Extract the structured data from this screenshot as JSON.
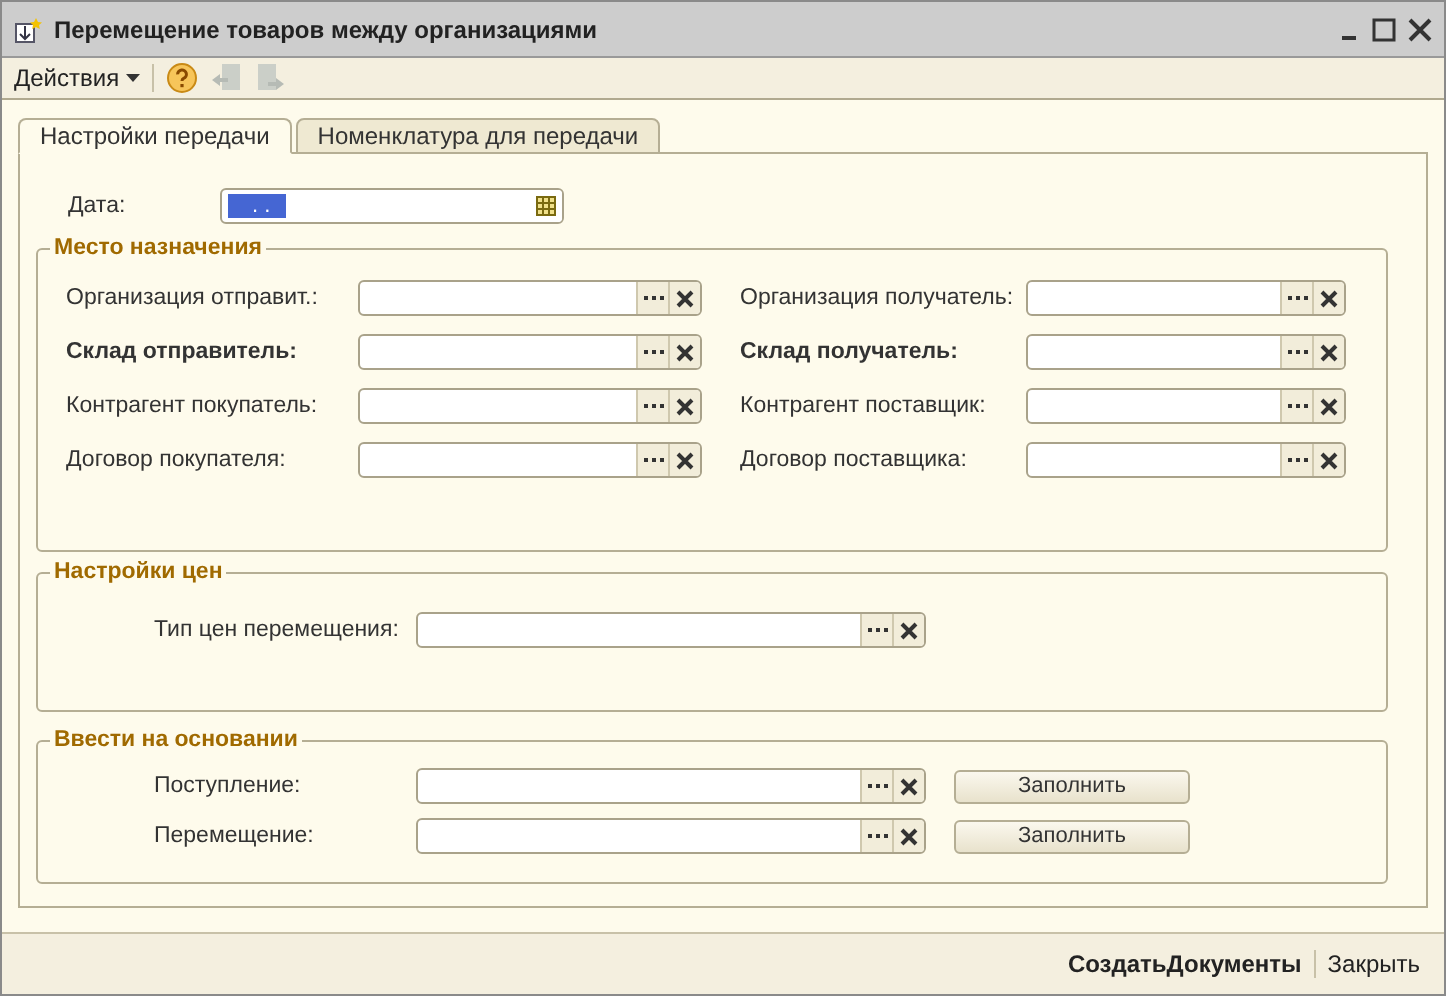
{
  "window": {
    "title": "Перемещение товаров между организациями"
  },
  "toolbar": {
    "menu": "Действия",
    "tools": [
      {
        "kind": "help",
        "disabled": false
      },
      {
        "kind": "back",
        "disabled": true
      },
      {
        "kind": "forward",
        "disabled": true
      }
    ]
  },
  "tabs": [
    {
      "label": "Настройки передачи",
      "selected": true
    },
    {
      "label": "Номенклатура для передачи",
      "selected": false
    }
  ],
  "date": {
    "label": "Дата:",
    "value": ". ."
  },
  "destination": {
    "title": "Место назначения",
    "left": [
      {
        "label": "Организация отправит.:",
        "bold": false
      },
      {
        "label": "Склад отправитель:",
        "bold": true
      },
      {
        "label": "Контрагент покупатель:",
        "bold": false
      },
      {
        "label": "Договор покупателя:",
        "bold": false
      }
    ],
    "right": [
      {
        "label": "Организация получатель:",
        "bold": false
      },
      {
        "label": "Склад получатель:",
        "bold": true
      },
      {
        "label": "Контрагент поставщик:",
        "bold": false
      },
      {
        "label": "Договор поставщика:",
        "bold": false
      }
    ]
  },
  "prices": {
    "title": "Настройки цен",
    "fields": [
      {
        "label": "Тип цен перемещения:",
        "bold": false
      }
    ]
  },
  "basis": {
    "title": "Ввести на основании",
    "fields": [
      {
        "label": "Поступление:",
        "bold": false,
        "button": "Заполнить"
      },
      {
        "label": "Перемещение:",
        "bold": false,
        "button": "Заполнить"
      }
    ]
  },
  "footer": {
    "buttons": [
      {
        "label": "СоздатьДокументы",
        "primary": true
      },
      {
        "label": "Закрыть",
        "primary": false
      }
    ]
  }
}
